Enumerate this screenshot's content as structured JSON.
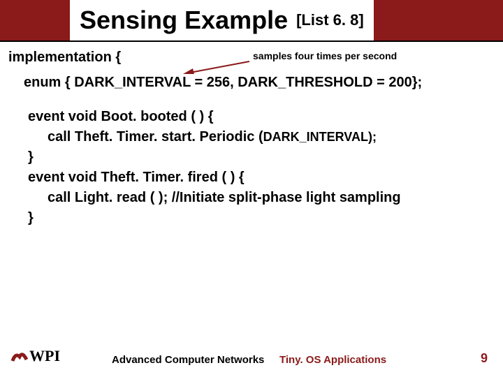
{
  "title": {
    "main": "Sensing Example",
    "sub": "[List 6. 8]"
  },
  "annotation": "samples four times per second",
  "code": {
    "impl": "implementation {",
    "enum": "enum { DARK_INTERVAL = 256, DARK_THRESHOLD = 200};",
    "line1": "event void Boot. booted ( ) {",
    "line2a": "call Theft. Timer. start. Periodic (",
    "line2b": "DARK_INTERVAL);",
    "line3": "}",
    "line4": "event void Theft. Timer. fired ( ) {",
    "line5": "call Light. read ( ); //Initiate split-phase light sampling",
    "line6": "}"
  },
  "footer": {
    "left": "Advanced Computer Networks",
    "right": "Tiny. OS Applications",
    "page": "9"
  },
  "logo": {
    "letters": "WPI"
  }
}
